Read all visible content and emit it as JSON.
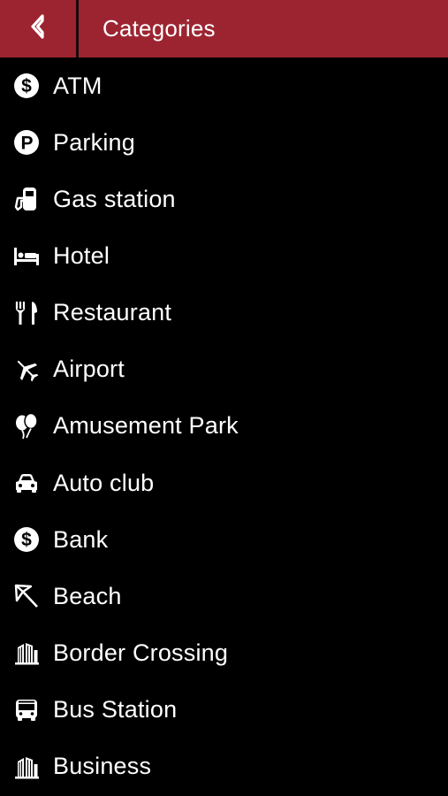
{
  "header": {
    "title": "Categories",
    "back_icon": "chevron-left-icon",
    "background": "#9c2430"
  },
  "categories": [
    {
      "label": "ATM",
      "icon": "dollar-circle-icon"
    },
    {
      "label": "Parking",
      "icon": "parking-icon"
    },
    {
      "label": "Gas station",
      "icon": "gas-pump-icon"
    },
    {
      "label": "Hotel",
      "icon": "bed-icon"
    },
    {
      "label": "Restaurant",
      "icon": "fork-knife-icon"
    },
    {
      "label": "Airport",
      "icon": "airplane-icon"
    },
    {
      "label": "Amusement Park",
      "icon": "balloons-icon"
    },
    {
      "label": "Auto club",
      "icon": "car-icon"
    },
    {
      "label": "Bank",
      "icon": "dollar-circle-icon"
    },
    {
      "label": "Beach",
      "icon": "beach-umbrella-icon"
    },
    {
      "label": "Border Crossing",
      "icon": "building-icon"
    },
    {
      "label": "Bus Station",
      "icon": "bus-icon"
    },
    {
      "label": "Business",
      "icon": "building-icon"
    }
  ]
}
